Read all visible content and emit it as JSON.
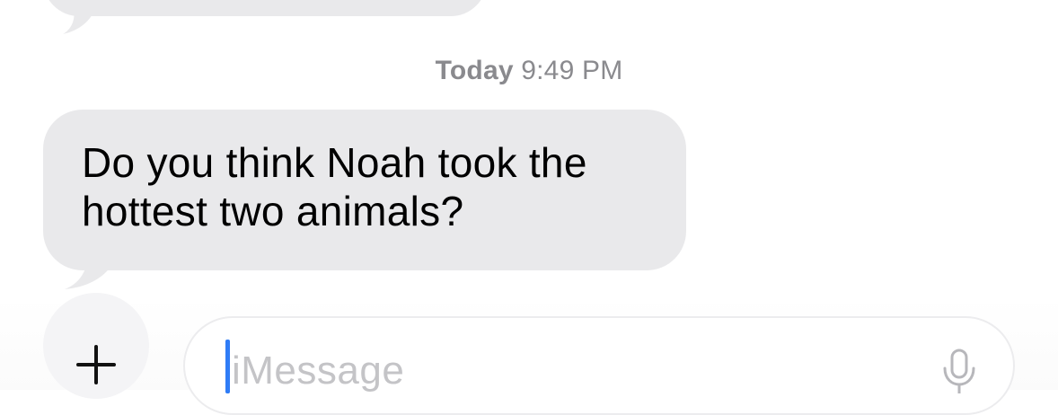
{
  "thread": {
    "timestamp_day": "Today",
    "timestamp_time": "9:49 PM",
    "messages": [
      {
        "direction": "incoming",
        "line1": "Do you think Noah took the",
        "line2": "hottest two animals?"
      }
    ]
  },
  "composer": {
    "placeholder": "iMessage",
    "plus_icon": "plus-icon",
    "mic_icon": "microphone-icon"
  },
  "colors": {
    "incoming_bubble": "#e9e9eb",
    "timestamp_text": "#8a8a8e",
    "caret": "#2f7cf6",
    "placeholder_text": "#c4c4c7"
  }
}
